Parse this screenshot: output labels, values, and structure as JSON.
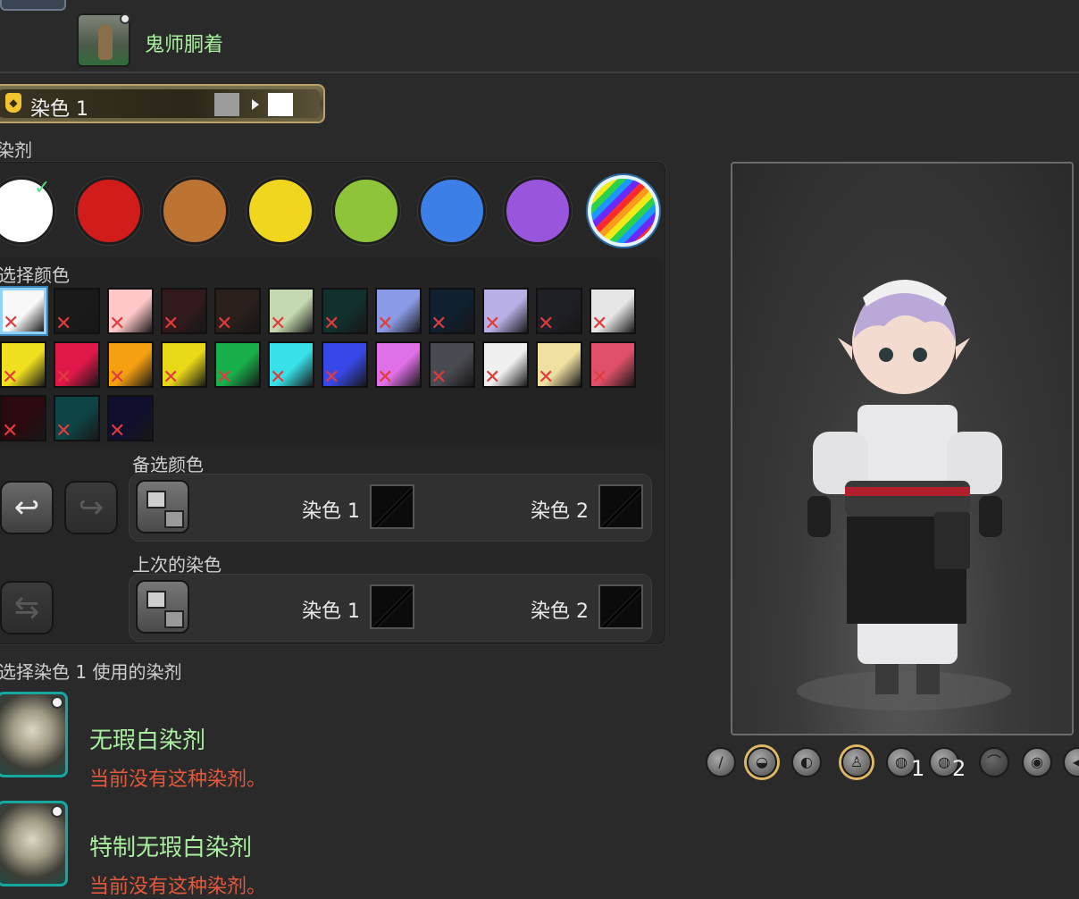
{
  "header": {
    "item_name": "鬼师胴着"
  },
  "dye_selector": {
    "label": "染色 1",
    "current_color": "#9b9b9b",
    "new_color": "#ffffff"
  },
  "dye_section_label": "染剂",
  "categories": [
    {
      "name": "white",
      "color": "#ffffff",
      "checked": true
    },
    {
      "name": "red",
      "color": "#d21b1b"
    },
    {
      "name": "brown",
      "color": "#bd7432"
    },
    {
      "name": "yellow",
      "color": "#f0d71e"
    },
    {
      "name": "green",
      "color": "#8ec43a"
    },
    {
      "name": "blue",
      "color": "#3c7fe6"
    },
    {
      "name": "purple",
      "color": "#9a55de"
    },
    {
      "name": "rainbow",
      "color": "rainbow",
      "selected": true
    }
  ],
  "check_glyph": "✓",
  "select_color_label": "选择颜色",
  "swatches": [
    [
      "#f8f8f8",
      "#1a1a1a",
      "#ffc8c8",
      "#321a1c",
      "#2a1f1a",
      "#c4d9b0",
      "#12302e",
      "#8a9ae6",
      "#0f2030",
      "#b8b0e6",
      "#1f1f26",
      "#e6e6e6"
    ],
    [
      "#f0e020",
      "#e0184a",
      "#f5a010",
      "#e8d818",
      "#18b04a",
      "#38e0e8",
      "#3848e8",
      "#e070e8",
      "#4a4a52",
      "#f0f0f0",
      "#f0e0a0",
      "#e0506a"
    ],
    [
      "#2a0a0e",
      "#0e4446",
      "#10102e"
    ]
  ],
  "x_glyph": "✕",
  "undo_glyph": "↩",
  "redo_glyph": "↪",
  "swap_glyph": "⇆",
  "alt_colors": {
    "label": "备选颜色",
    "slot1": "染色 1",
    "slot2": "染色 2"
  },
  "last_dye": {
    "label": "上次的染色",
    "slot1": "染色 1",
    "slot2": "染色 2"
  },
  "dye_list_label": "选择染色 1 使用的染剂",
  "dye_items": [
    {
      "name": "无瑕白染剂",
      "note": "当前没有这种染剂。"
    },
    {
      "name": "特制无瑕白染剂",
      "note": "当前没有这种染剂。"
    }
  ],
  "toolbar": {
    "num1": "1",
    "num2": "2"
  }
}
